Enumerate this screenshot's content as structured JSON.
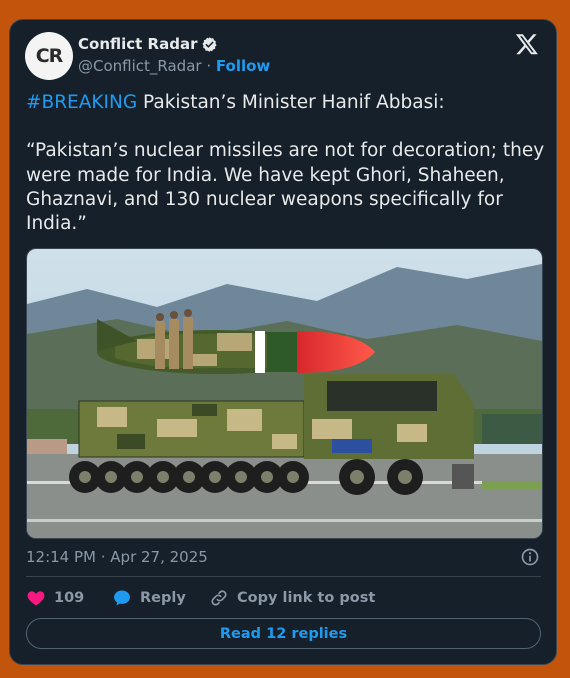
{
  "author": {
    "avatar_text": "CR",
    "display_name": "Conflict Radar",
    "handle": "@Conflict_Radar",
    "separator": " · ",
    "follow_label": "Follow"
  },
  "tweet": {
    "hashtag": "#BREAKING",
    "headline": " Pakistan’s Minister Hanif Abbasi:",
    "quote": "“Pakistan’s nuclear missiles are not for decoration; they were made for India. We have kept Ghori, Shaheen, Ghaznavi, and 130 nuclear weapons specifically for India.”",
    "media_description": "Missile on multi-axle transporter truck with soldiers at a military parade",
    "timestamp": "12:14 PM · Apr 27, 2025"
  },
  "actions": {
    "like_count": "109",
    "reply_label": "Reply",
    "copy_label": "Copy link to post",
    "read_replies_label": "Read 12 replies"
  },
  "colors": {
    "background": "#c3540c",
    "card": "#15202b",
    "accent": "#1d9bf0",
    "like": "#f91880"
  }
}
